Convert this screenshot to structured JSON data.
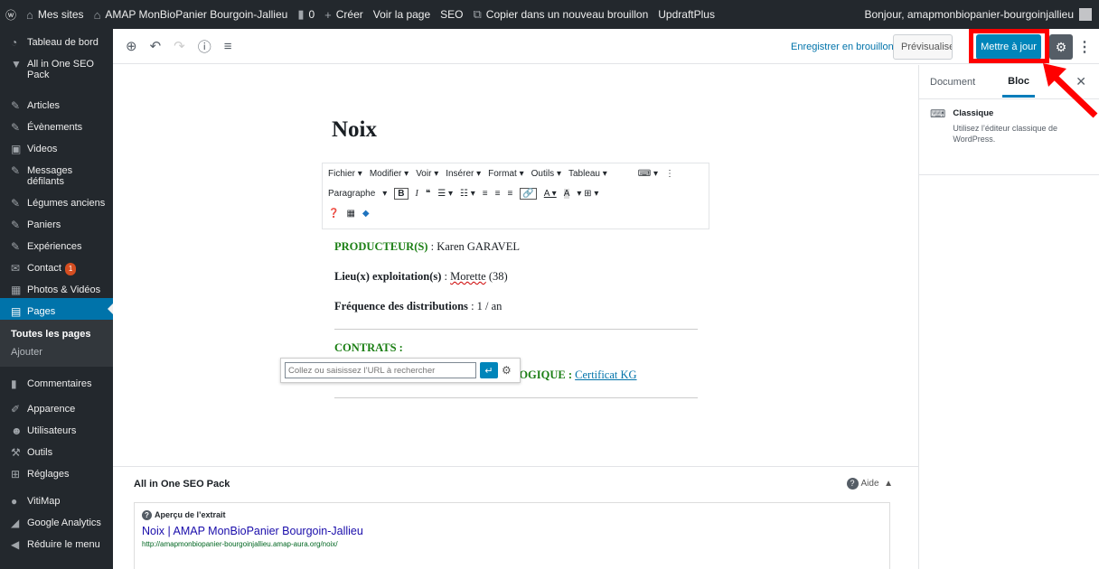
{
  "adminbar": {
    "my_sites": "Mes sites",
    "site_name": "AMAP MonBioPanier Bourgoin-Jallieu",
    "comments_count": "0",
    "create": "Créer",
    "view_page": "Voir la page",
    "seo": "SEO",
    "copy_draft": "Copier dans un nouveau brouillon",
    "updraft": "UpdraftPlus",
    "greeting": "Bonjour, amapmonbiopanier-bourgoinjallieu"
  },
  "sidebar": {
    "items": [
      {
        "label": "Tableau de bord",
        "icon": "dashboard-icon"
      },
      {
        "label": "All in One SEO Pack",
        "icon": "seo-icon"
      },
      {
        "label": "Articles",
        "icon": "pin-icon"
      },
      {
        "label": "Évènements",
        "icon": "pin-icon"
      },
      {
        "label": "Videos",
        "icon": "video-icon"
      },
      {
        "label": "Messages défilants",
        "icon": "pin-icon"
      },
      {
        "label": "Légumes anciens",
        "icon": "pin-icon"
      },
      {
        "label": "Paniers",
        "icon": "pin-icon"
      },
      {
        "label": "Expériences",
        "icon": "pin-icon"
      },
      {
        "label": "Contact",
        "icon": "mail-icon",
        "badge": "1"
      },
      {
        "label": "Photos & Vidéos",
        "icon": "media-icon"
      },
      {
        "label": "Pages",
        "icon": "pages-icon"
      }
    ],
    "pages_sub": {
      "all": "Toutes les pages",
      "add": "Ajouter"
    },
    "items2": [
      {
        "label": "Commentaires",
        "icon": "comment-icon"
      },
      {
        "label": "Apparence",
        "icon": "brush-icon"
      },
      {
        "label": "Utilisateurs",
        "icon": "users-icon"
      },
      {
        "label": "Outils",
        "icon": "wrench-icon"
      },
      {
        "label": "Réglages",
        "icon": "settings-icon"
      },
      {
        "label": "VitiMap",
        "icon": "map-icon"
      },
      {
        "label": "Google Analytics",
        "icon": "chart-icon"
      },
      {
        "label": "Réduire le menu",
        "icon": "collapse-icon"
      }
    ]
  },
  "toolbar": {
    "save_draft": "Enregistrer en brouillon",
    "preview": "Prévisualiser",
    "update": "Mettre à jour"
  },
  "panel": {
    "tab_document": "Document",
    "tab_block": "Bloc",
    "block_title": "Classique",
    "block_desc": "Utilisez l’éditeur classique de WordPress."
  },
  "editor": {
    "title": "Noix",
    "menu": [
      "Fichier ▾",
      "Modifier ▾",
      "Voir ▾",
      "Insérer ▾",
      "Format ▾",
      "Outils ▾",
      "Tableau ▾"
    ],
    "format_select": "Paragraphe",
    "producer_label": "PRODUCTEUR(S)",
    "producer_value": " : Karen GARAVEL",
    "location_label": "Lieu(x) exploitation(s)",
    "location_sep": " : ",
    "location_value": "Morette",
    "location_code": " (38)",
    "freq_label": "Fréquence des distributions",
    "freq_value": " : 1 / an",
    "contracts_label": "CONTRATS :",
    "bio_label": "LOGIQUE : ",
    "bio_link": "Certificat KG",
    "url_placeholder": "Collez ou saisissez l’URL à rechercher"
  },
  "seo": {
    "title": "All in One SEO Pack",
    "help": "Aide",
    "preview_label": "Aperçu de l’extrait",
    "snippet_title": "Noix | AMAP MonBioPanier Bourgoin-Jallieu",
    "snippet_url": "http://amapmonbiopanier-bourgoinjallieu.amap-aura.org/noix/"
  }
}
